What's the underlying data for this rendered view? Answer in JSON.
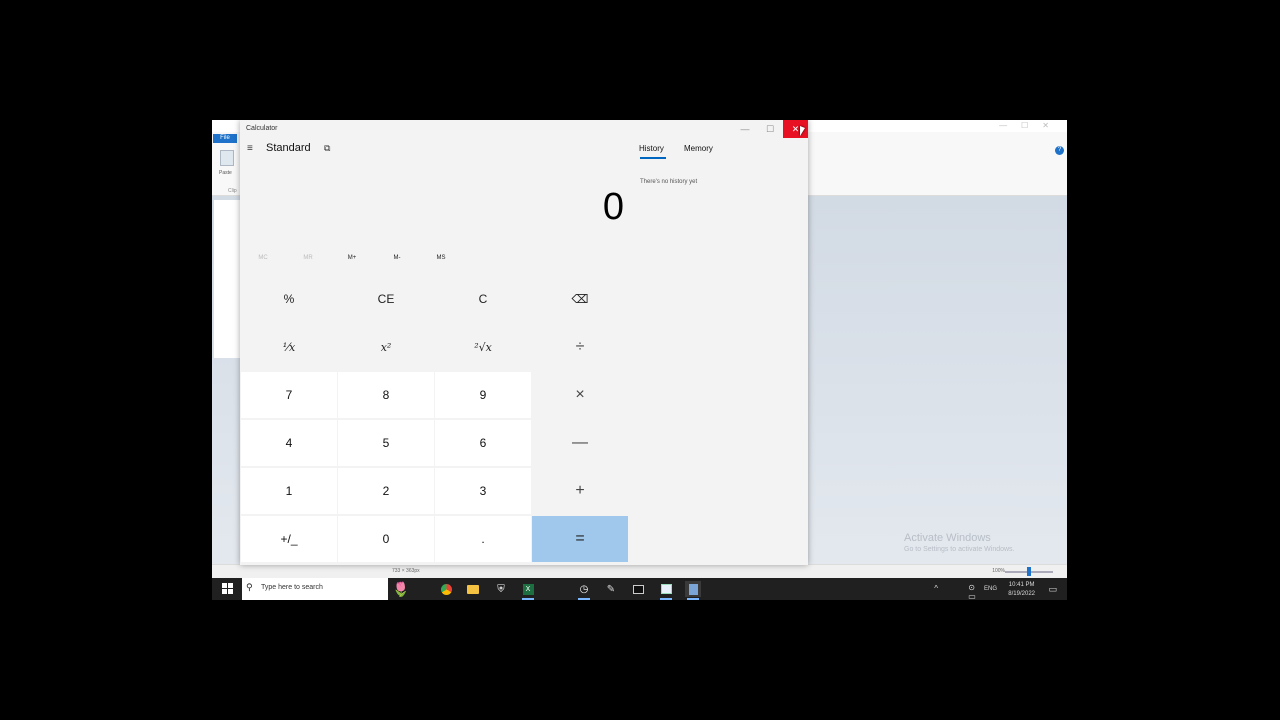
{
  "paint": {
    "file_tab": "File",
    "paste_label": "Paste",
    "clipboard_label": "Clip",
    "help_label": "?",
    "status_size": "733 × 363px",
    "zoom_level": "100%",
    "zoom_fraction": 0.5
  },
  "watermark": {
    "title": "Activate Windows",
    "subtitle": "Go to Settings to activate Windows."
  },
  "calculator": {
    "window_title": "Calculator",
    "minimize_label": "—",
    "maximize_label": "☐",
    "close_label": "✕",
    "menu_glyph": "≡",
    "mode": "Standard",
    "keep_on_top_glyph": "⧉",
    "display_value": "0",
    "memory_buttons": [
      {
        "label": "MC",
        "enabled": false
      },
      {
        "label": "MR",
        "enabled": false
      },
      {
        "label": "M+",
        "enabled": true
      },
      {
        "label": "M-",
        "enabled": true
      },
      {
        "label": "MS",
        "enabled": true
      }
    ],
    "keys": {
      "percent": "%",
      "clear_entry": "CE",
      "clear": "C",
      "backspace": "⌫",
      "reciprocal": "⅟x",
      "square": "x²",
      "sqrt": "²√x",
      "divide": "÷",
      "seven": "7",
      "eight": "8",
      "nine": "9",
      "multiply": "×",
      "four": "4",
      "five": "5",
      "six": "6",
      "minus": "—",
      "one": "1",
      "two": "2",
      "three": "3",
      "plus": "+",
      "negate": "+/_",
      "zero": "0",
      "decimal": ".",
      "equals": "="
    },
    "history_tab": "History",
    "memory_tab": "Memory",
    "history_empty": "There's no history yet"
  },
  "taskbar": {
    "search_placeholder": "Type here to search",
    "search_art": "🌷",
    "defender_glyph": "⛨",
    "clock_glyph": "◷",
    "feather_glyph": "✎",
    "excel_letter": "X",
    "tray_up": "^",
    "tray_icons": "⊙ ▭ ◁)",
    "language": "ENG",
    "time": "10:41 PM",
    "date": "8/19/2022",
    "notification_glyph": "▭"
  },
  "colors": {
    "close_red": "#e81123",
    "equals_blue": "#9fc8ec",
    "accent_blue": "#0067c0",
    "taskbar": "#202020"
  }
}
